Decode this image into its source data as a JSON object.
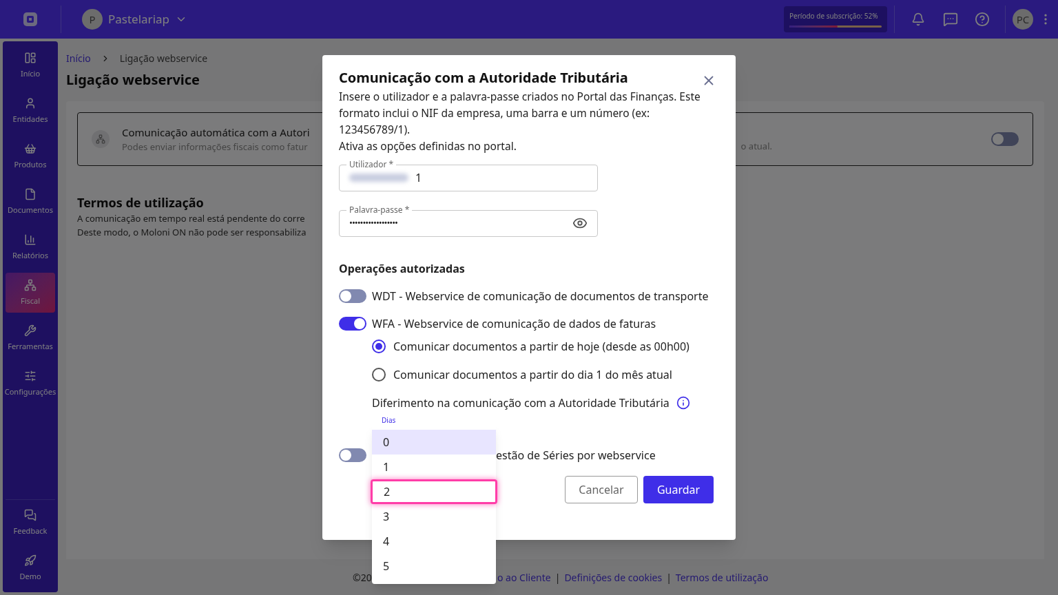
{
  "header": {
    "company": {
      "initial": "P",
      "name": "Pastelariap"
    },
    "subscription": {
      "label": "Período de subscrição: 52%",
      "level": 0.52
    },
    "user": {
      "initials": "PC"
    }
  },
  "sidebar": {
    "items": [
      {
        "label": "Início",
        "selected": false
      },
      {
        "label": "Entidades",
        "selected": false
      },
      {
        "label": "Produtos",
        "selected": false
      },
      {
        "label": "Documentos",
        "selected": false
      },
      {
        "label": "Relatórios",
        "selected": false
      },
      {
        "label": "Fiscal",
        "selected": true
      },
      {
        "label": "Ferramentas",
        "selected": false
      },
      {
        "label": "Configurações",
        "selected": false
      }
    ],
    "bottom_items": [
      {
        "label": "Feedback",
        "selected": false
      },
      {
        "label": "Demo",
        "selected": false
      }
    ]
  },
  "breadcrumb": [
    {
      "label": "Início"
    },
    {
      "label": "Ligação webservice"
    }
  ],
  "page_title": "Ligação webservice",
  "card": {
    "title": "Comunicação automática com a Autori",
    "subtitle": "Podes enviar informações fiscais como fatur",
    "subtitle_end": "o atual.",
    "on": false
  },
  "terms": {
    "title": "Termos de utilização",
    "lines": [
      "A comunicação em tempo real está pendente do corre",
      "Deste modo, o Moloni ON não pode ser responsabiliza"
    ]
  },
  "footer": {
    "start": "©20",
    "items": [
      {
        "kind": "link",
        "text": "o ao Cliente"
      },
      {
        "kind": "separator",
        "text": "|"
      },
      {
        "kind": "link",
        "text": "Definições de cookies"
      },
      {
        "kind": "separator",
        "text": "|"
      },
      {
        "kind": "link",
        "text": "Termos de utilização"
      }
    ]
  },
  "modal": {
    "title": "Comunicação com a Autoridade Tributária",
    "description": [
      "Insere o utilizador e a palavra-passe criados no Portal das Finanças. Este formato inclui o NIF da empresa, uma barra e um número (ex: 123456789/1).",
      "Ativa as opções definidas no portal."
    ],
    "user_field": {
      "label": "Utilizador *",
      "value": "1"
    },
    "password_field": {
      "label": "Palavra-passe *",
      "value": "••••••••••••••••••"
    },
    "operations_title": "Operações autorizadas",
    "operations": [
      {
        "label": "WDT - Webservice de comunicação de documentos de transporte",
        "on": false
      },
      {
        "label": "WFA - Webservice de comunicação de dados de faturas",
        "on": true
      }
    ],
    "radios": [
      {
        "label": "Comunicar documentos a partir de hoje (desde as 00h00)",
        "selected": true
      },
      {
        "label": "Comunicar documentos a partir do dia 1 do mês atual",
        "selected": false
      }
    ],
    "deferral_label": "Diferimento na comunicação com a Autoridade Tributária",
    "days_label": "Dias",
    "days_options": [
      {
        "label": "0",
        "selected": true,
        "focused": false
      },
      {
        "label": "1",
        "selected": false,
        "focused": false
      },
      {
        "label": "2",
        "selected": false,
        "focused": true
      },
      {
        "label": "3",
        "selected": false,
        "focused": false
      },
      {
        "label": "4",
        "selected": false,
        "focused": false
      },
      {
        "label": "5",
        "selected": false,
        "focused": false
      }
    ],
    "series": {
      "label": "estão de Séries por webservice",
      "on": false
    },
    "buttons": {
      "cancel": "Cancelar",
      "save": "Guardar"
    }
  }
}
